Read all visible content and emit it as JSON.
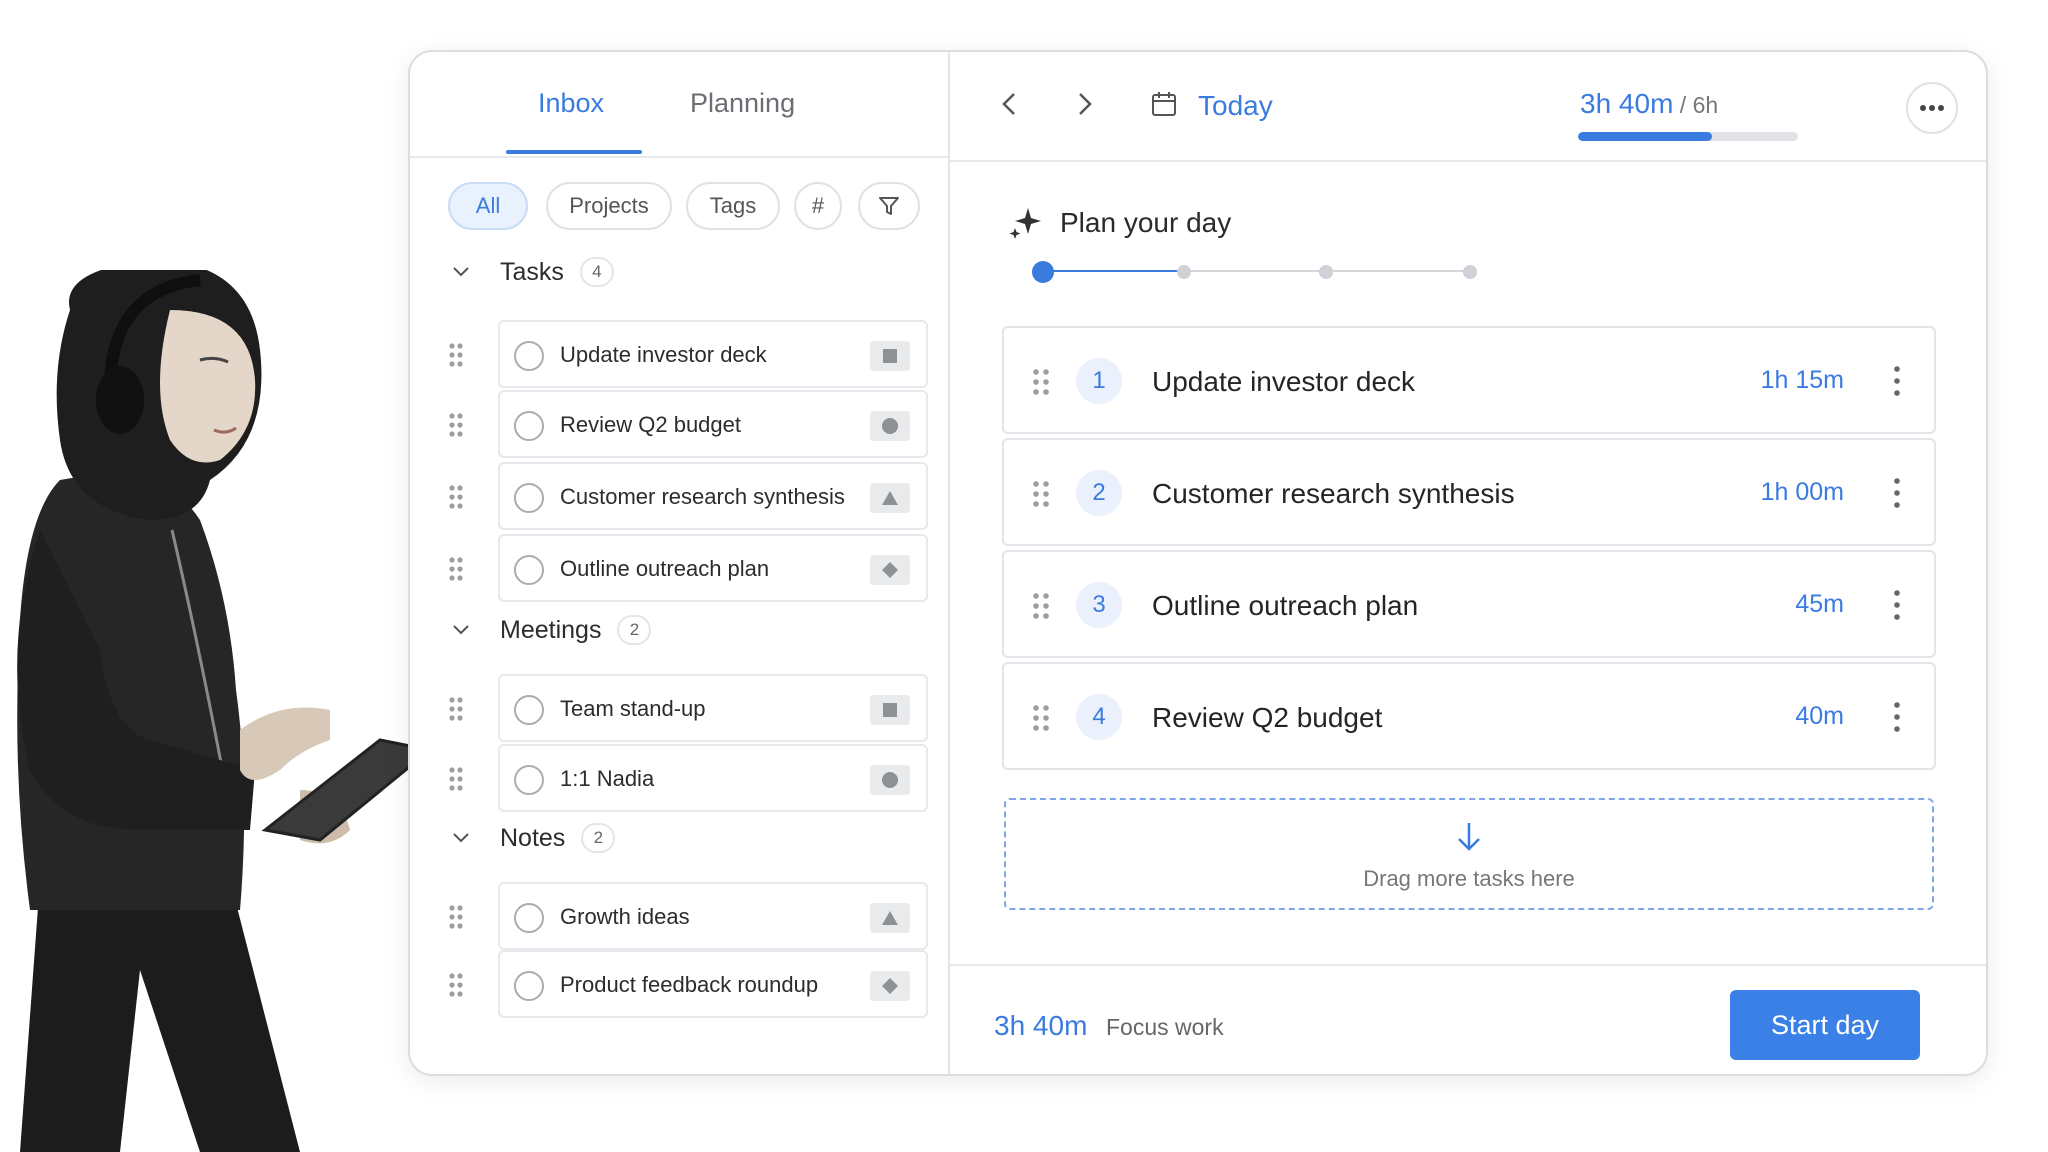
{
  "tabs": [
    {
      "label": "Inbox",
      "active": true
    },
    {
      "label": "Planning",
      "active": false
    }
  ],
  "filters": {
    "all": "All",
    "projects": "Projects",
    "tags": "Tags",
    "hash": "#",
    "filter_icon": "filter-icon"
  },
  "sections": {
    "tasks": {
      "title": "Tasks",
      "count": "4",
      "items": [
        {
          "label": "Update investor deck",
          "shape": "square"
        },
        {
          "label": "Review Q2 budget",
          "shape": "circle"
        },
        {
          "label": "Customer research synthesis",
          "shape": "triangle"
        },
        {
          "label": "Outline outreach plan",
          "shape": "diamond"
        }
      ]
    },
    "meetings": {
      "title": "Meetings",
      "count": "2",
      "items": [
        {
          "label": "Team stand-up",
          "shape": "square"
        },
        {
          "label": "1:1 Nadia",
          "shape": "circle"
        }
      ]
    },
    "notes": {
      "title": "Notes",
      "count": "2",
      "items": [
        {
          "label": "Growth ideas",
          "shape": "triangle"
        },
        {
          "label": "Product feedback roundup",
          "shape": "diamond"
        }
      ]
    }
  },
  "header": {
    "today": "Today",
    "progress_done": "3h 40m",
    "progress_sep": " / ",
    "progress_total": "6h",
    "progress_fraction": 0.61
  },
  "plan": {
    "title": "Plan your day",
    "steps_total": 4,
    "current_step": 1,
    "items": [
      {
        "num": "1",
        "label": "Update investor deck",
        "duration": "1h 15m"
      },
      {
        "num": "2",
        "label": "Customer research synthesis",
        "duration": "1h 00m"
      },
      {
        "num": "3",
        "label": "Outline outreach plan",
        "duration": "45m"
      },
      {
        "num": "4",
        "label": "Review Q2 budget",
        "duration": "40m"
      }
    ],
    "dropzone": "Drag more tasks here"
  },
  "footer": {
    "total": "3h 40m",
    "label": "Focus work",
    "start": "Start day"
  },
  "colors": {
    "accent": "#3a7be0",
    "border": "#e3e5e8",
    "muted": "#6b6e73"
  }
}
